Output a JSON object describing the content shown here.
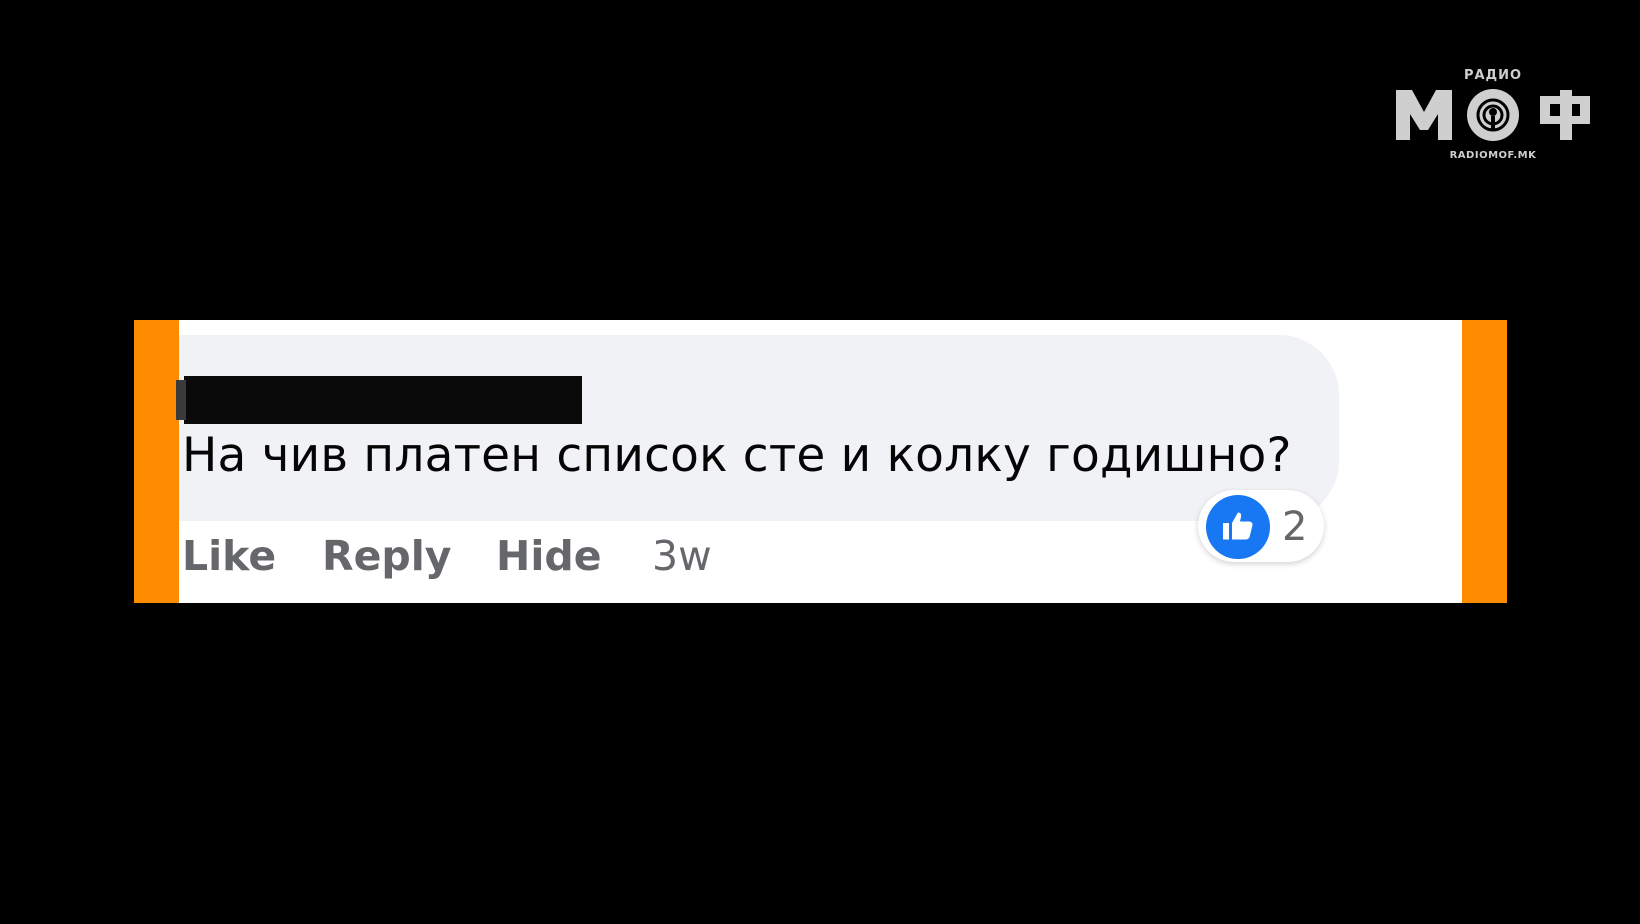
{
  "logo": {
    "top_text": "РАДИО",
    "main_text": "МОФ",
    "bottom_text": "RADIOMOF.MK",
    "color": "#cfcfcf"
  },
  "comment": {
    "author": "",
    "text": "На чив платен список сте и колку годишно?",
    "reaction_icon": "like-icon",
    "reaction_count": "2",
    "actions": {
      "like_label": "Like",
      "reply_label": "Reply",
      "hide_label": "Hide"
    },
    "timestamp": "3w"
  },
  "colors": {
    "background": "#000000",
    "accent_bar": "#ff8c00",
    "bubble": "#f0f2f5",
    "like_blue": "#1877f2",
    "secondary_text": "#65676b"
  }
}
